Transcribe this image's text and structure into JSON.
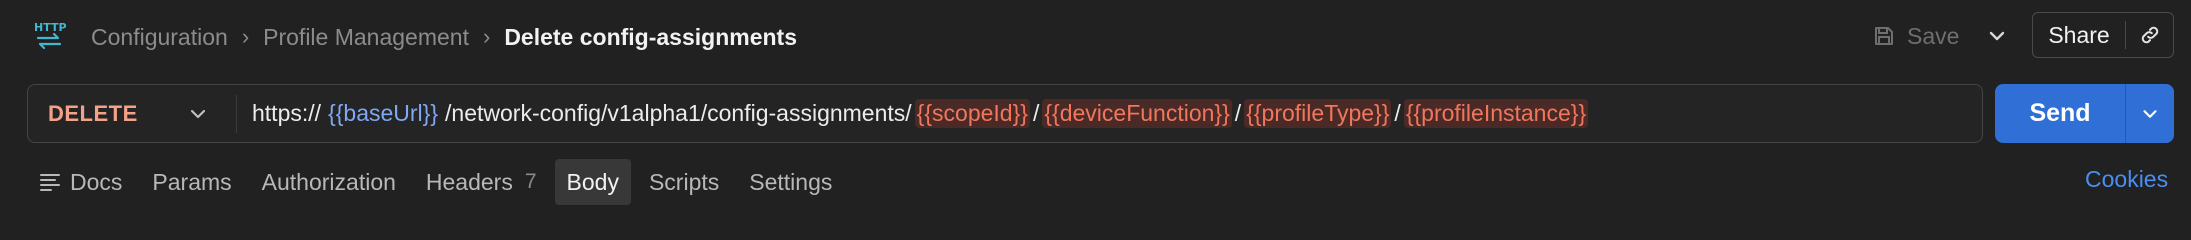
{
  "header": {
    "icon": "http-request-icon",
    "icon_text": "HTTP",
    "breadcrumb": [
      {
        "label": "Configuration"
      },
      {
        "label": "Profile Management"
      }
    ],
    "current_title": "Delete config-assignments",
    "save_label": "Save",
    "share_label": "Share"
  },
  "request": {
    "method": "DELETE",
    "url_parts": {
      "scheme": "https://",
      "base_var": "{{baseUrl}}",
      "path": "/network-config/v1alpha1/config-assignments/",
      "var1": "{{scopeId}}",
      "sep1": "/",
      "var2": "{{deviceFunction}}",
      "sep2": "/",
      "var3": "{{profileType}}",
      "sep3": "/",
      "var4": "{{profileInstance}}"
    },
    "send_label": "Send"
  },
  "tabs": [
    {
      "label": "Docs"
    },
    {
      "label": "Params"
    },
    {
      "label": "Authorization"
    },
    {
      "label": "Headers",
      "count": "7"
    },
    {
      "label": "Body",
      "active": true
    },
    {
      "label": "Scripts"
    },
    {
      "label": "Settings"
    }
  ],
  "cookies_label": "Cookies",
  "colors": {
    "background": "#212121",
    "method": "#f4a18a",
    "var_resolved": "#7fa7f2",
    "var_unresolved": "#f2765c",
    "send": "#2f6fd6",
    "link": "#4a8ef0"
  }
}
